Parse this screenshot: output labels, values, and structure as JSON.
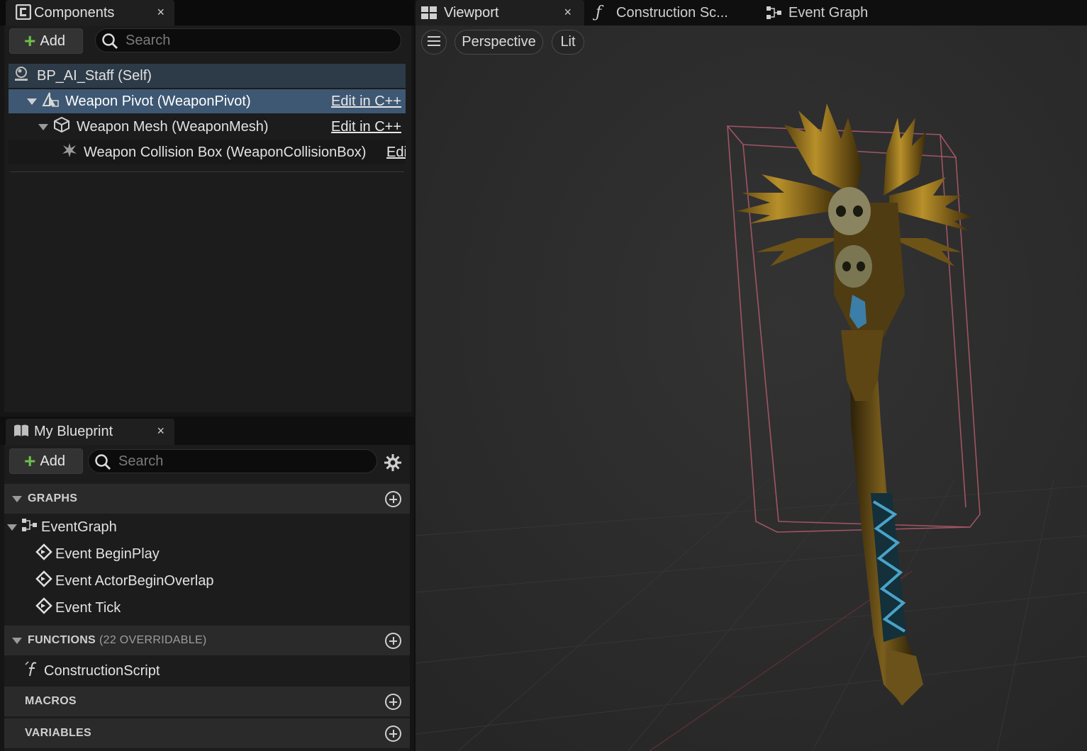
{
  "components_panel": {
    "tab_label": "Components",
    "close_glyph": "×",
    "add_label": "Add",
    "search_placeholder": "Search",
    "tree": [
      {
        "label": "BP_AI_Staff (Self)"
      },
      {
        "label": "Weapon Pivot (WeaponPivot)",
        "action": "Edit in C++"
      },
      {
        "label": "Weapon Mesh (WeaponMesh)",
        "action": "Edit in C++"
      },
      {
        "label": "Weapon Collision Box (WeaponCollisionBox)",
        "action": "Edit in C++"
      }
    ]
  },
  "blueprint_panel": {
    "tab_label": "My Blueprint",
    "close_glyph": "×",
    "add_label": "Add",
    "search_placeholder": "Search",
    "sections": {
      "graphs": {
        "label": "GRAPHS"
      },
      "functions": {
        "label": "FUNCTIONS",
        "sub": "(22 OVERRIDABLE)"
      },
      "macros": {
        "label": "MACROS"
      },
      "variables": {
        "label": "VARIABLES"
      }
    },
    "event_graph": "EventGraph",
    "events": [
      "Event BeginPlay",
      "Event ActorBeginOverlap",
      "Event Tick"
    ],
    "functions": [
      "ConstructionScript"
    ]
  },
  "editor_tabs": {
    "viewport": "Viewport",
    "viewport_close": "×",
    "construction": "Construction Sc...",
    "event_graph": "Event Graph"
  },
  "viewport": {
    "perspective_label": "Perspective",
    "lit_label": "Lit"
  },
  "colors": {
    "selection": "#3e5873",
    "self_row": "#2d3a47",
    "add_plus": "#6cc04a",
    "bounds_box": "#b55b6e"
  }
}
